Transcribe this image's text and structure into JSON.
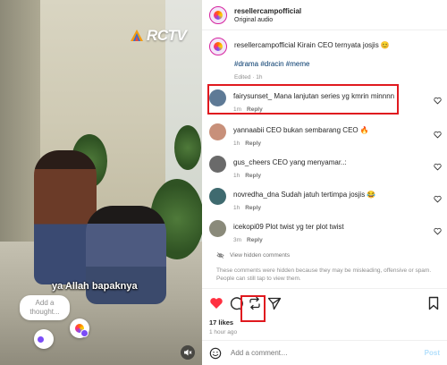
{
  "video": {
    "channel_logo": "RCTV",
    "subtitle": "ya Allah bapaknya",
    "thought_placeholder": "Add a thought...",
    "mute_icon": "speaker-muted-icon"
  },
  "header": {
    "username": "resellercampofficial",
    "audio": "Original audio"
  },
  "caption": {
    "text": "resellercampofficial Kirain CEO ternyata josjis 😊",
    "tags": "#drama #dracin #meme",
    "meta": "Edited · 1h"
  },
  "comments": [
    {
      "text": "fairysunset_ Mana lanjutan series yg kmrin minnnn",
      "time": "1m",
      "reply": "Reply",
      "avatar_color": "#5e7a96",
      "highlighted": true
    },
    {
      "text": "yannaabii CEO bukan sembarang CEO 🔥",
      "time": "1h",
      "reply": "Reply",
      "avatar_color": "#c8907a",
      "highlighted": false
    },
    {
      "text": "gus_cheers CEO yang menyamar..:",
      "time": "1h",
      "reply": "Reply",
      "avatar_color": "#6a6a6a",
      "highlighted": false
    },
    {
      "text": "novredha_dna Sudah jatuh tertimpa josjis 😂",
      "time": "1h",
      "reply": "Reply",
      "avatar_color": "#3f6a6f",
      "highlighted": false
    },
    {
      "text": "icekopi09 Plot twist yg ter plot twist",
      "time": "3m",
      "reply": "Reply",
      "avatar_color": "#8a8a7a",
      "highlighted": false
    }
  ],
  "hidden": {
    "link": "View hidden comments",
    "note": "These comments were hidden because they may be misleading, offensive or spam. People can still tap to view them."
  },
  "actions": {
    "likes": "17 likes",
    "time_ago": "1 hour ago",
    "like_color": "#ff3040",
    "highlight_color": "#e0191f"
  },
  "composer": {
    "placeholder": "Add a comment…",
    "post_label": "Post"
  }
}
